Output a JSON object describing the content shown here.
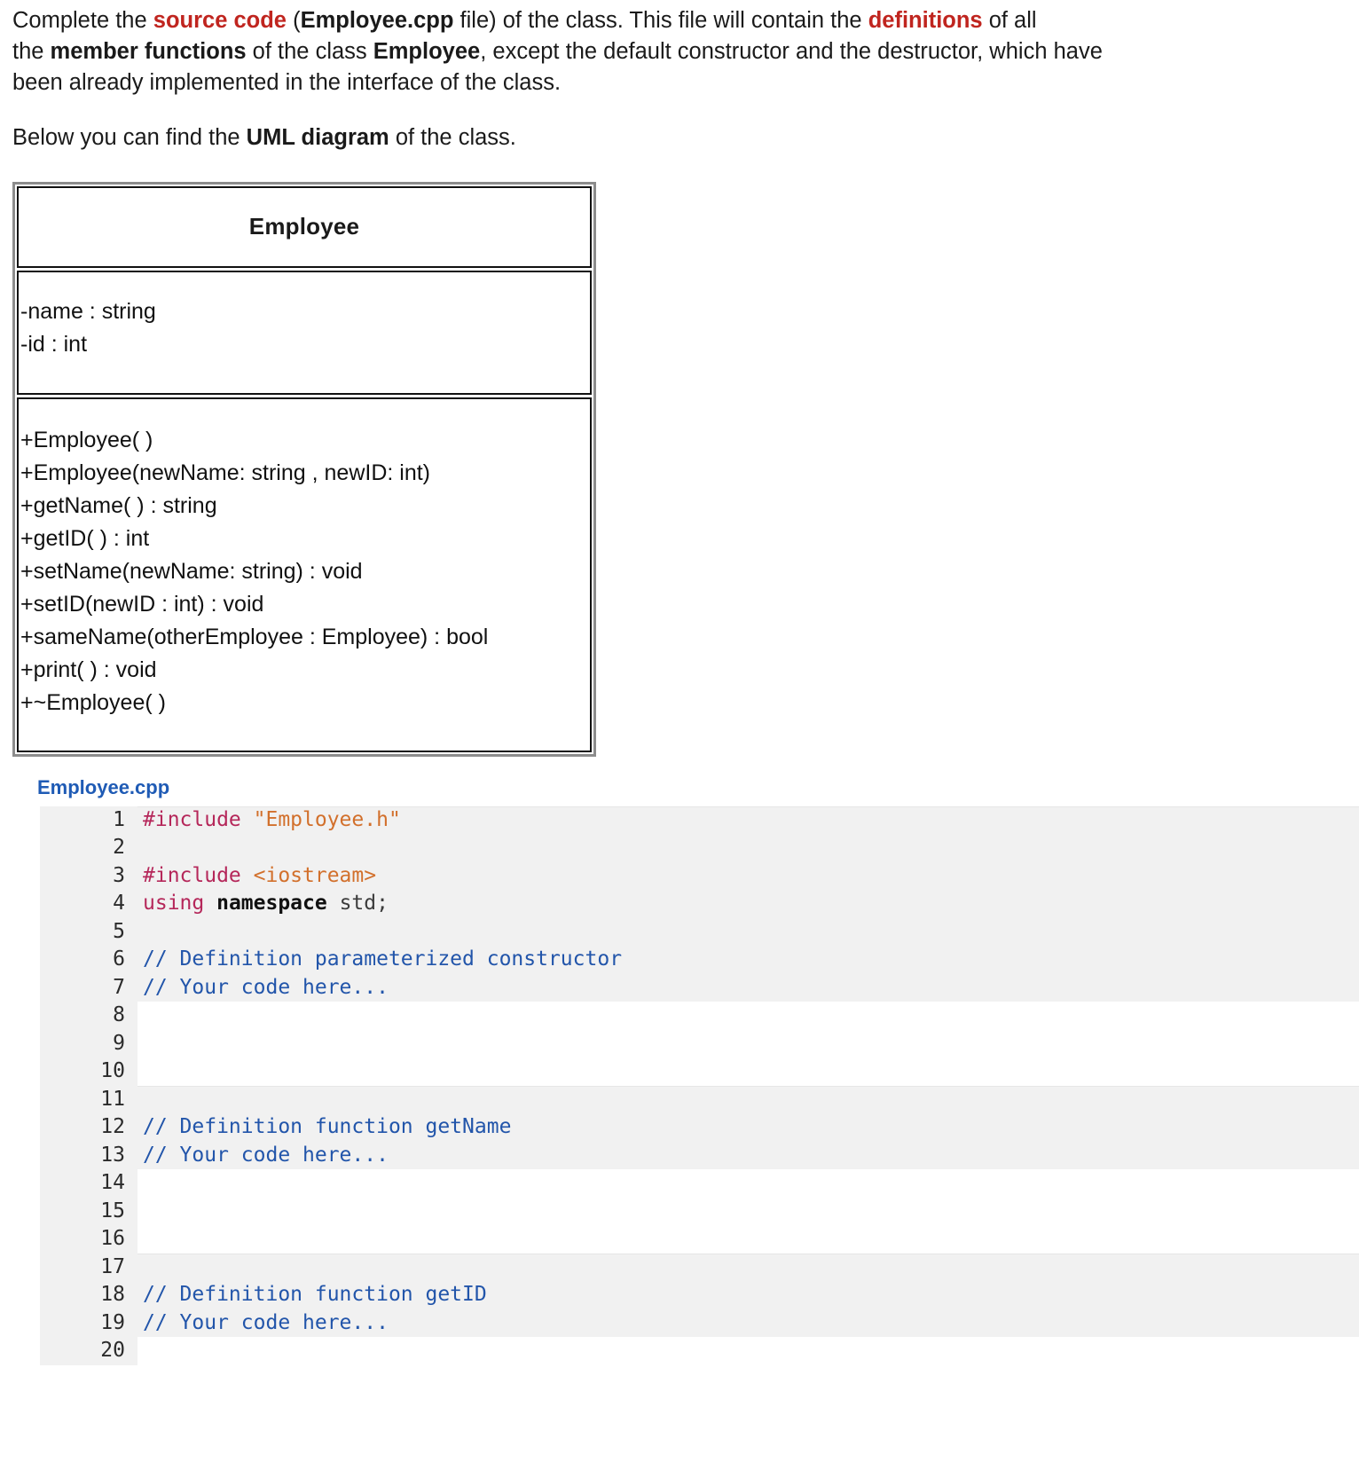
{
  "intro": {
    "line1_a": "Complete the ",
    "line1_red": "source code",
    "line1_b": " (",
    "line1_bold": "Employee.cpp",
    "line1_c": " file) of the class. This file will contain the ",
    "line1_red2": "definitions",
    "line1_d": " of all",
    "line2_a": "the ",
    "line2_bold": "member functions",
    "line2_b": " of the class ",
    "line2_bold2": "Employee",
    "line2_c": ", except the default constructor and the destructor, which have",
    "line3": "been already implemented in the interface of the class.",
    "line4_a": "Below you can find the ",
    "line4_bold": "UML diagram",
    "line4_b": " of the class."
  },
  "uml": {
    "class_name": "Employee",
    "attributes": [
      "-name : string",
      "-id : int"
    ],
    "operations": [
      "+Employee( )",
      "+Employee(newName: string , newID: int)",
      "+getName( ) : string",
      "+getID( ) : int",
      "+setName(newName: string) : void",
      "+setID(newID : int) : void",
      "+sameName(otherEmployee : Employee) : bool",
      "+print( ) : void",
      "+~Employee( )"
    ]
  },
  "editor": {
    "file_label": "Employee.cpp",
    "lines": [
      {
        "n": "1",
        "editable": false,
        "band_start": true,
        "tokens": [
          {
            "t": "#include ",
            "c": "tok-pre"
          },
          {
            "t": "\"Employee.h\"",
            "c": "tok-str"
          }
        ]
      },
      {
        "n": "2",
        "editable": false,
        "band_start": false,
        "tokens": []
      },
      {
        "n": "3",
        "editable": false,
        "band_start": false,
        "tokens": [
          {
            "t": "#include ",
            "c": "tok-pre"
          },
          {
            "t": "<iostream>",
            "c": "tok-str"
          }
        ]
      },
      {
        "n": "4",
        "editable": false,
        "band_start": false,
        "tokens": [
          {
            "t": "using ",
            "c": "tok-kw"
          },
          {
            "t": "namespace",
            "c": "tok-bold"
          },
          {
            "t": " std;",
            "c": "tok-pln"
          }
        ]
      },
      {
        "n": "5",
        "editable": false,
        "band_start": false,
        "tokens": []
      },
      {
        "n": "6",
        "editable": false,
        "band_start": false,
        "tokens": [
          {
            "t": "// Definition parameterized constructor",
            "c": "tok-cmt"
          }
        ]
      },
      {
        "n": "7",
        "editable": false,
        "band_start": false,
        "tokens": [
          {
            "t": "// Your code here...",
            "c": "tok-cmt"
          }
        ]
      },
      {
        "n": "8",
        "editable": true,
        "band_start": true,
        "tokens": []
      },
      {
        "n": "9",
        "editable": true,
        "band_start": false,
        "tokens": []
      },
      {
        "n": "10",
        "editable": true,
        "band_start": false,
        "tokens": []
      },
      {
        "n": "11",
        "editable": false,
        "band_start": true,
        "tokens": []
      },
      {
        "n": "12",
        "editable": false,
        "band_start": false,
        "tokens": [
          {
            "t": "// Definition function getName",
            "c": "tok-cmt"
          }
        ]
      },
      {
        "n": "13",
        "editable": false,
        "band_start": false,
        "tokens": [
          {
            "t": "// Your code here...",
            "c": "tok-cmt"
          }
        ]
      },
      {
        "n": "14",
        "editable": true,
        "band_start": true,
        "tokens": []
      },
      {
        "n": "15",
        "editable": true,
        "band_start": false,
        "tokens": []
      },
      {
        "n": "16",
        "editable": true,
        "band_start": false,
        "tokens": []
      },
      {
        "n": "17",
        "editable": false,
        "band_start": true,
        "tokens": []
      },
      {
        "n": "18",
        "editable": false,
        "band_start": false,
        "tokens": [
          {
            "t": "// Definition function getID",
            "c": "tok-cmt"
          }
        ]
      },
      {
        "n": "19",
        "editable": false,
        "band_start": false,
        "tokens": [
          {
            "t": "// Your code here...",
            "c": "tok-cmt"
          }
        ]
      },
      {
        "n": "20",
        "editable": true,
        "band_start": true,
        "tokens": []
      }
    ]
  }
}
